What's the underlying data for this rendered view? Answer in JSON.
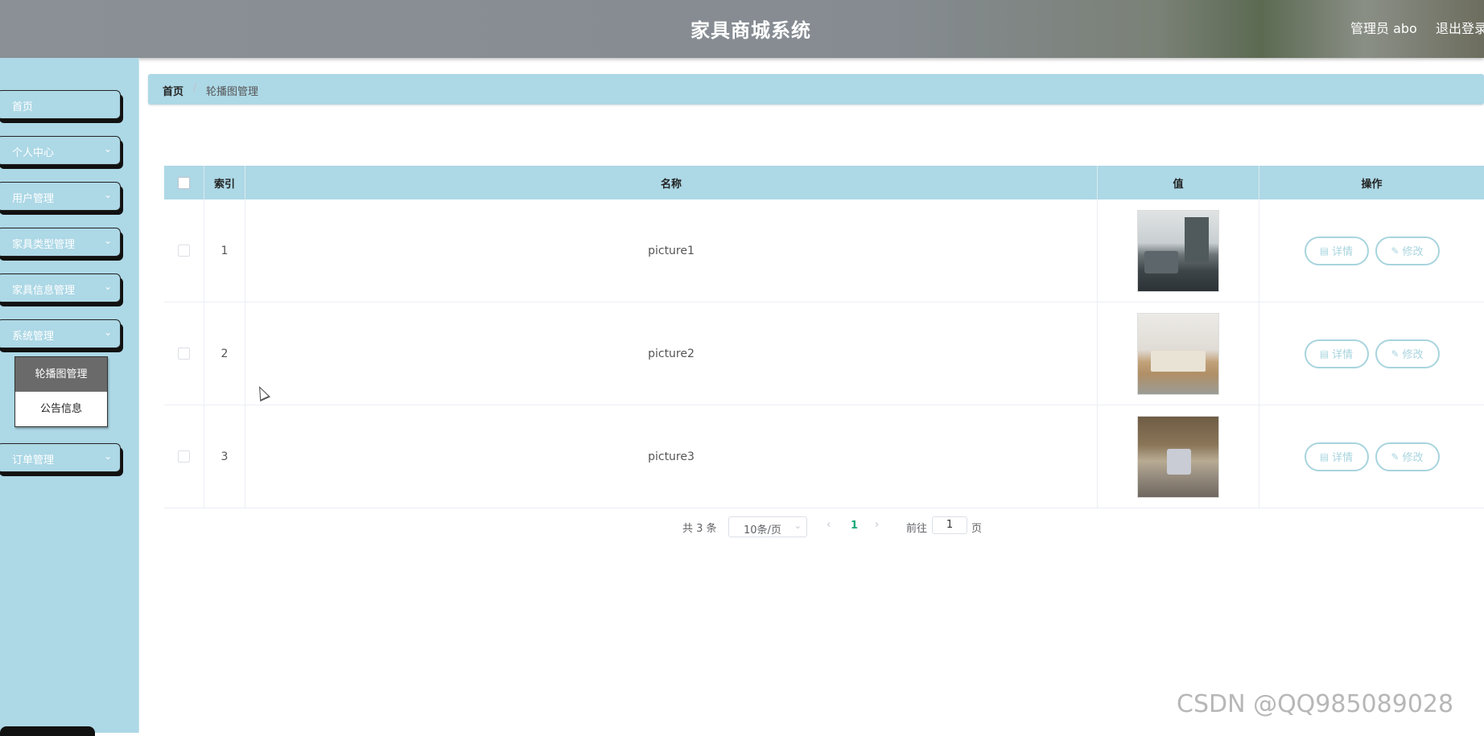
{
  "header": {
    "title": "家具商城系统",
    "user": "管理员 abo",
    "logout": "退出登录"
  },
  "sidebar": {
    "items": [
      {
        "label": "首页",
        "has_arrow": false
      },
      {
        "label": "个人中心",
        "has_arrow": true
      },
      {
        "label": "用户管理",
        "has_arrow": true
      },
      {
        "label": "家具类型管理",
        "has_arrow": true
      },
      {
        "label": "家具信息管理",
        "has_arrow": true
      },
      {
        "label": "系统管理",
        "has_arrow": true
      },
      {
        "label": "订单管理",
        "has_arrow": true
      }
    ],
    "submenu": [
      {
        "label": "轮播图管理",
        "active": true
      },
      {
        "label": "公告信息",
        "active": false
      }
    ]
  },
  "breadcrumb": {
    "home": "首页",
    "current": "轮播图管理"
  },
  "table": {
    "columns": [
      "索引",
      "名称",
      "值",
      "操作"
    ],
    "rows": [
      {
        "index": "1",
        "name": "picture1"
      },
      {
        "index": "2",
        "name": "picture2"
      },
      {
        "index": "3",
        "name": "picture3"
      }
    ],
    "actions": {
      "detail": "详情",
      "edit": "修改"
    }
  },
  "pagination": {
    "total": "共 3 条",
    "page_size": "10条/页",
    "current_page": "1",
    "goto_label": "前往",
    "goto_value": "1",
    "page_suffix": "页"
  },
  "watermark": "CSDN @QQ985089028"
}
